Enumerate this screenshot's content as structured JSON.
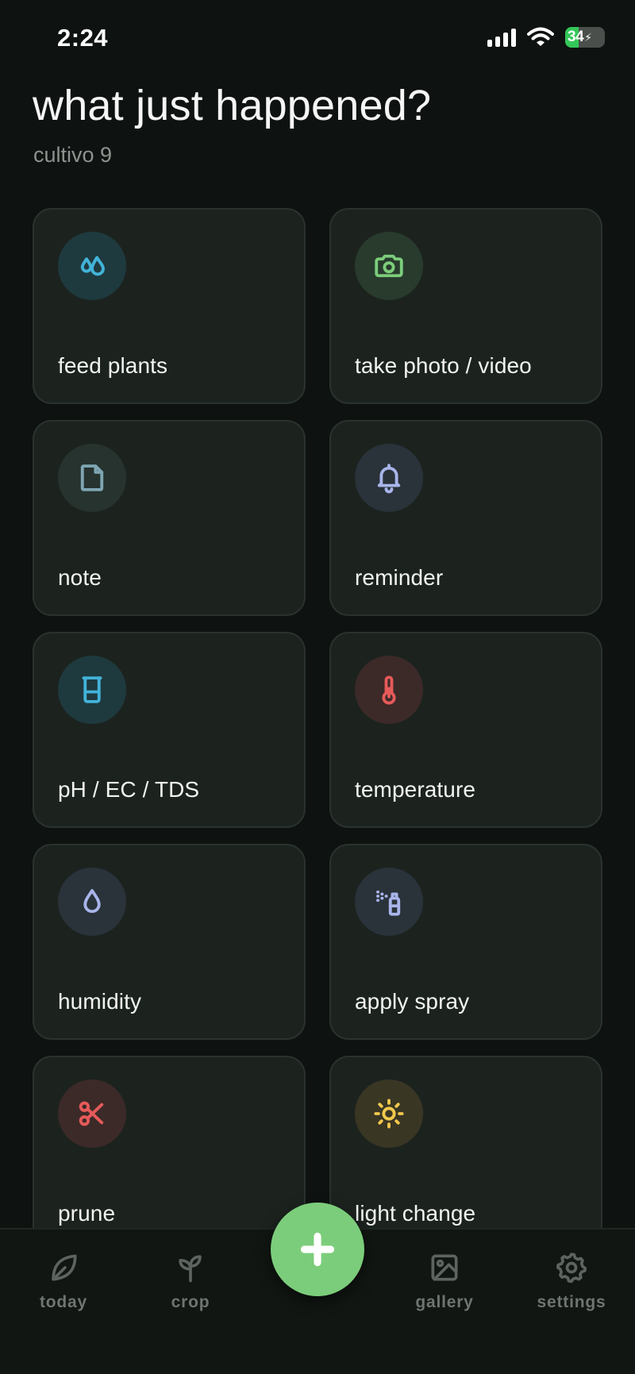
{
  "status_bar": {
    "time": "2:24",
    "battery_level": "34"
  },
  "header": {
    "title": "what just happened?",
    "subtitle": "cultivo 9"
  },
  "actions": [
    {
      "label": "feed plants",
      "icon": "water-drops-icon",
      "color": "#42b3d9",
      "bg": "#1e3a3f"
    },
    {
      "label": "take photo / video",
      "icon": "camera-icon",
      "color": "#7ccd7b",
      "bg": "#283b2d"
    },
    {
      "label": "note",
      "icon": "note-icon",
      "color": "#7fa6b3",
      "bg": "#27332f"
    },
    {
      "label": "reminder",
      "icon": "bell-icon",
      "color": "#a9b5ea",
      "bg": "#2a323a"
    },
    {
      "label": "pH / EC / TDS",
      "icon": "beaker-icon",
      "color": "#42b3d9",
      "bg": "#1e3a3f"
    },
    {
      "label": "temperature",
      "icon": "thermometer-icon",
      "color": "#e65a5a",
      "bg": "#3c2a28"
    },
    {
      "label": "humidity",
      "icon": "drop-icon",
      "color": "#a9b5ea",
      "bg": "#2a323a"
    },
    {
      "label": "apply spray",
      "icon": "spray-icon",
      "color": "#a9b5ea",
      "bg": "#2a323a"
    },
    {
      "label": "prune",
      "icon": "scissors-icon",
      "color": "#e65a5a",
      "bg": "#3c2a28"
    },
    {
      "label": "light change",
      "icon": "sun-icon",
      "color": "#f2c94c",
      "bg": "#3a3624"
    }
  ],
  "nav": {
    "today": "today",
    "crop": "crop",
    "gallery": "gallery",
    "settings": "settings"
  },
  "fab": {
    "icon": "plus-icon",
    "color": "#7ccd7b"
  }
}
